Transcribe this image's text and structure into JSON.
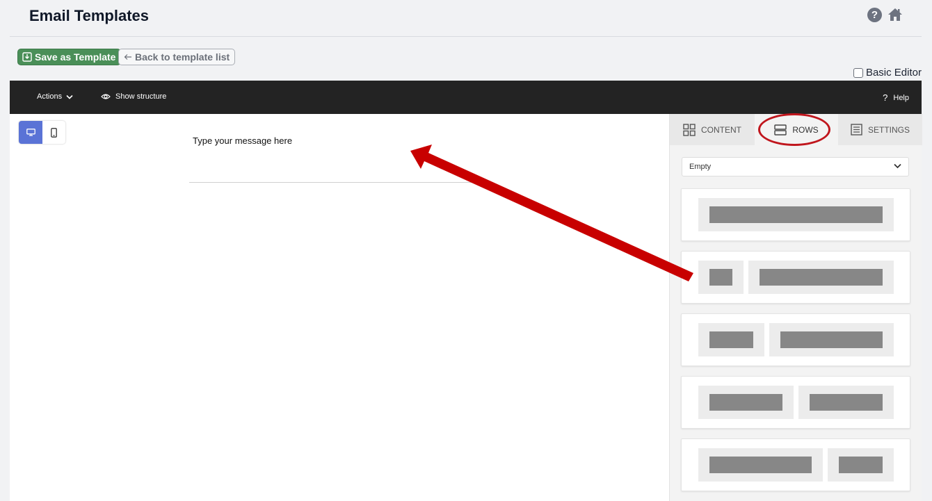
{
  "header": {
    "title": "Email Templates",
    "help_glyph": "?"
  },
  "actions": {
    "save_label": "Save as Template",
    "back_label": "Back to template list",
    "basic_editor_label": "Basic Editor"
  },
  "toolbar": {
    "actions_label": "Actions",
    "structure_label": "Show structure",
    "help_label": "Help",
    "help_glyph": "?"
  },
  "canvas": {
    "message": "Type your message here"
  },
  "sidebar": {
    "tabs": [
      {
        "label": "CONTENT",
        "icon": "grid-icon"
      },
      {
        "label": "ROWS",
        "icon": "rows-icon",
        "active": true
      },
      {
        "label": "SETTINGS",
        "icon": "settings-list-icon"
      }
    ],
    "select_value": "Empty"
  },
  "colors": {
    "save_green": "#4a8f58",
    "toolbar_dark": "#232323",
    "device_active": "#5a73d6",
    "annotation_red": "#c0161d"
  }
}
